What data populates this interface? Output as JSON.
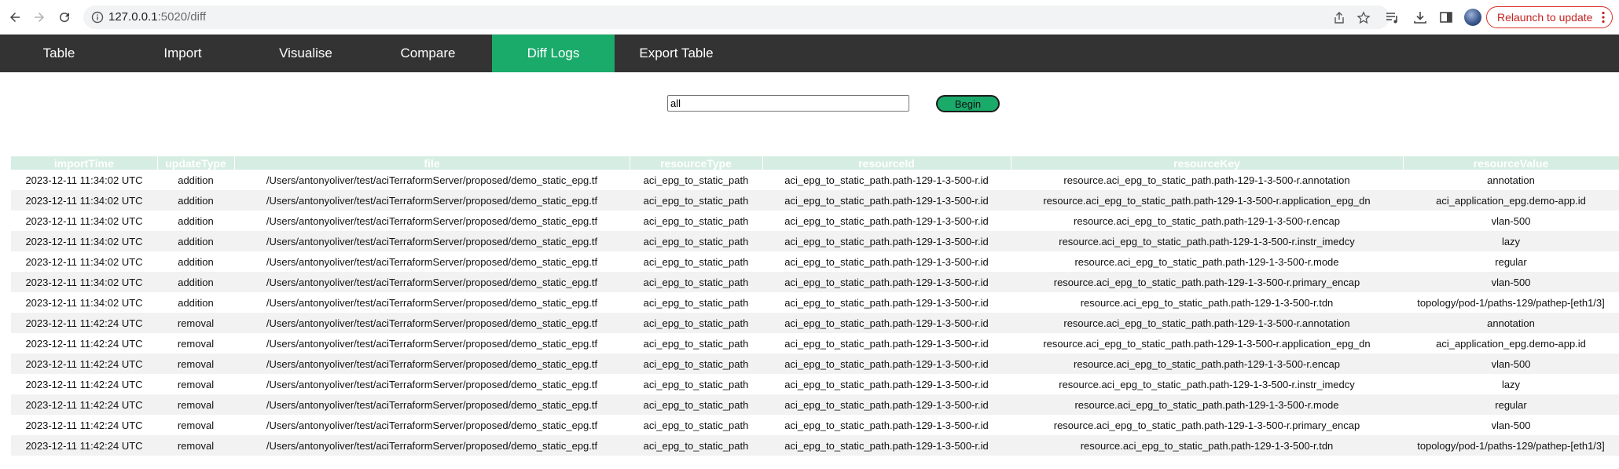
{
  "browser": {
    "url_host": "127.0.0.1",
    "url_path": ":5020/diff",
    "relaunch_label": "Relaunch to update"
  },
  "nav": {
    "tabs": [
      {
        "label": "Table",
        "active": false
      },
      {
        "label": "Import",
        "active": false
      },
      {
        "label": "Visualise",
        "active": false
      },
      {
        "label": "Compare",
        "active": false
      },
      {
        "label": "Diff Logs",
        "active": true
      },
      {
        "label": "Export Table",
        "active": false
      }
    ]
  },
  "search": {
    "value": "all",
    "begin_label": "Begin"
  },
  "table": {
    "columns": [
      "importTime",
      "updateType",
      "file",
      "resourceType",
      "resourceId",
      "resourceKey",
      "resourceValue"
    ],
    "rows": [
      [
        "2023-12-11 11:34:02 UTC",
        "addition",
        "/Users/antonyoliver/test/aciTerraformServer/proposed/demo_static_epg.tf",
        "aci_epg_to_static_path",
        "aci_epg_to_static_path.path-129-1-3-500-r.id",
        "resource.aci_epg_to_static_path.path-129-1-3-500-r.annotation",
        "annotation"
      ],
      [
        "2023-12-11 11:34:02 UTC",
        "addition",
        "/Users/antonyoliver/test/aciTerraformServer/proposed/demo_static_epg.tf",
        "aci_epg_to_static_path",
        "aci_epg_to_static_path.path-129-1-3-500-r.id",
        "resource.aci_epg_to_static_path.path-129-1-3-500-r.application_epg_dn",
        "aci_application_epg.demo-app.id"
      ],
      [
        "2023-12-11 11:34:02 UTC",
        "addition",
        "/Users/antonyoliver/test/aciTerraformServer/proposed/demo_static_epg.tf",
        "aci_epg_to_static_path",
        "aci_epg_to_static_path.path-129-1-3-500-r.id",
        "resource.aci_epg_to_static_path.path-129-1-3-500-r.encap",
        "vlan-500"
      ],
      [
        "2023-12-11 11:34:02 UTC",
        "addition",
        "/Users/antonyoliver/test/aciTerraformServer/proposed/demo_static_epg.tf",
        "aci_epg_to_static_path",
        "aci_epg_to_static_path.path-129-1-3-500-r.id",
        "resource.aci_epg_to_static_path.path-129-1-3-500-r.instr_imedcy",
        "lazy"
      ],
      [
        "2023-12-11 11:34:02 UTC",
        "addition",
        "/Users/antonyoliver/test/aciTerraformServer/proposed/demo_static_epg.tf",
        "aci_epg_to_static_path",
        "aci_epg_to_static_path.path-129-1-3-500-r.id",
        "resource.aci_epg_to_static_path.path-129-1-3-500-r.mode",
        "regular"
      ],
      [
        "2023-12-11 11:34:02 UTC",
        "addition",
        "/Users/antonyoliver/test/aciTerraformServer/proposed/demo_static_epg.tf",
        "aci_epg_to_static_path",
        "aci_epg_to_static_path.path-129-1-3-500-r.id",
        "resource.aci_epg_to_static_path.path-129-1-3-500-r.primary_encap",
        "vlan-500"
      ],
      [
        "2023-12-11 11:34:02 UTC",
        "addition",
        "/Users/antonyoliver/test/aciTerraformServer/proposed/demo_static_epg.tf",
        "aci_epg_to_static_path",
        "aci_epg_to_static_path.path-129-1-3-500-r.id",
        "resource.aci_epg_to_static_path.path-129-1-3-500-r.tdn",
        "topology/pod-1/paths-129/pathep-[eth1/3]"
      ],
      [
        "2023-12-11 11:42:24 UTC",
        "removal",
        "/Users/antonyoliver/test/aciTerraformServer/proposed/demo_static_epg.tf",
        "aci_epg_to_static_path",
        "aci_epg_to_static_path.path-129-1-3-500-r.id",
        "resource.aci_epg_to_static_path.path-129-1-3-500-r.annotation",
        "annotation"
      ],
      [
        "2023-12-11 11:42:24 UTC",
        "removal",
        "/Users/antonyoliver/test/aciTerraformServer/proposed/demo_static_epg.tf",
        "aci_epg_to_static_path",
        "aci_epg_to_static_path.path-129-1-3-500-r.id",
        "resource.aci_epg_to_static_path.path-129-1-3-500-r.application_epg_dn",
        "aci_application_epg.demo-app.id"
      ],
      [
        "2023-12-11 11:42:24 UTC",
        "removal",
        "/Users/antonyoliver/test/aciTerraformServer/proposed/demo_static_epg.tf",
        "aci_epg_to_static_path",
        "aci_epg_to_static_path.path-129-1-3-500-r.id",
        "resource.aci_epg_to_static_path.path-129-1-3-500-r.encap",
        "vlan-500"
      ],
      [
        "2023-12-11 11:42:24 UTC",
        "removal",
        "/Users/antonyoliver/test/aciTerraformServer/proposed/demo_static_epg.tf",
        "aci_epg_to_static_path",
        "aci_epg_to_static_path.path-129-1-3-500-r.id",
        "resource.aci_epg_to_static_path.path-129-1-3-500-r.instr_imedcy",
        "lazy"
      ],
      [
        "2023-12-11 11:42:24 UTC",
        "removal",
        "/Users/antonyoliver/test/aciTerraformServer/proposed/demo_static_epg.tf",
        "aci_epg_to_static_path",
        "aci_epg_to_static_path.path-129-1-3-500-r.id",
        "resource.aci_epg_to_static_path.path-129-1-3-500-r.mode",
        "regular"
      ],
      [
        "2023-12-11 11:42:24 UTC",
        "removal",
        "/Users/antonyoliver/test/aciTerraformServer/proposed/demo_static_epg.tf",
        "aci_epg_to_static_path",
        "aci_epg_to_static_path.path-129-1-3-500-r.id",
        "resource.aci_epg_to_static_path.path-129-1-3-500-r.primary_encap",
        "vlan-500"
      ],
      [
        "2023-12-11 11:42:24 UTC",
        "removal",
        "/Users/antonyoliver/test/aciTerraformServer/proposed/demo_static_epg.tf",
        "aci_epg_to_static_path",
        "aci_epg_to_static_path.path-129-1-3-500-r.id",
        "resource.aci_epg_to_static_path.path-129-1-3-500-r.tdn",
        "topology/pod-1/paths-129/pathep-[eth1/3]"
      ]
    ]
  },
  "colors": {
    "nav_bg": "#333333",
    "accent": "#1aab6b",
    "header_bg": "#d6ede3",
    "row_alt": "#f2f2f2"
  }
}
